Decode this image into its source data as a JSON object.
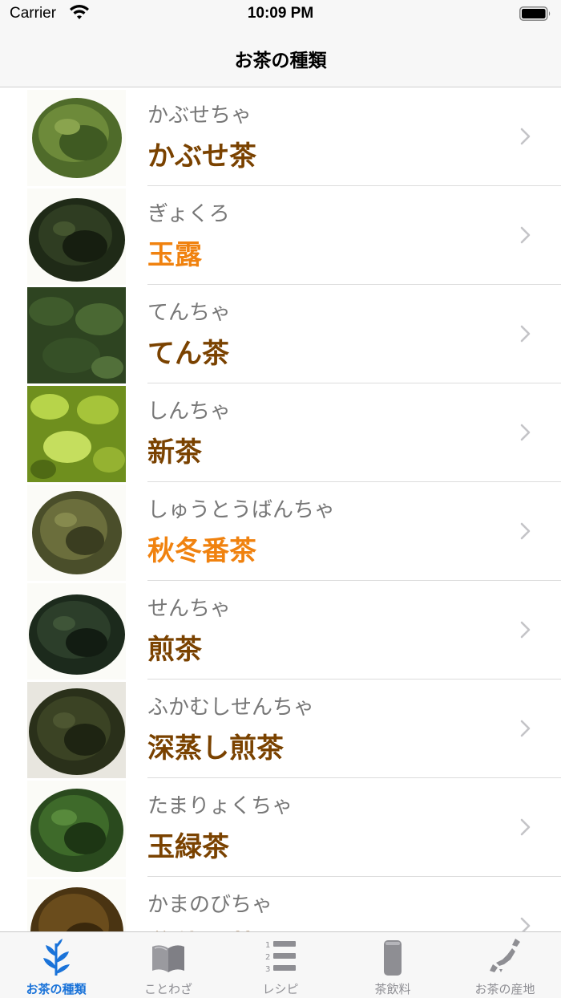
{
  "status_bar": {
    "carrier": "Carrier",
    "time": "10:09 PM"
  },
  "nav": {
    "title": "お茶の種類"
  },
  "colors": {
    "brown": "#7a4200",
    "orange": "#f0820f",
    "reading": "#777777",
    "tab_active": "#1a73d9",
    "tab_inactive": "#8e8e93"
  },
  "teas": [
    {
      "reading": "かぶせちゃ",
      "name": "かぶせ茶",
      "name_color": "#7a4200",
      "thumb": "loose-leaf"
    },
    {
      "reading": "ぎょくろ",
      "name": "玉露",
      "name_color": "#f0820f",
      "thumb": "dark-needle"
    },
    {
      "reading": "てんちゃ",
      "name": "てん茶",
      "name_color": "#7a4200",
      "thumb": "flakes"
    },
    {
      "reading": "しんちゃ",
      "name": "新茶",
      "name_color": "#7a4200",
      "thumb": "fresh-leaves"
    },
    {
      "reading": "しゅうとうばんちゃ",
      "name": "秋冬番茶",
      "name_color": "#f0820f",
      "thumb": "loose-leaf"
    },
    {
      "reading": "せんちゃ",
      "name": "煎茶",
      "name_color": "#7a4200",
      "thumb": "dark-needle"
    },
    {
      "reading": "ふかむしせんちゃ",
      "name": "深蒸し煎茶",
      "name_color": "#7a4200",
      "thumb": "dark-fine"
    },
    {
      "reading": "たまりょくちゃ",
      "name": "玉緑茶",
      "name_color": "#7a4200",
      "thumb": "curled"
    },
    {
      "reading": "かまのびちゃ",
      "name": "釜伸び茶",
      "name_color": "#7a4200",
      "thumb": "brown"
    }
  ],
  "tabs": [
    {
      "label": "お茶の種類",
      "icon": "tea-plant-icon",
      "active": true
    },
    {
      "label": "ことわざ",
      "icon": "book-icon",
      "active": false
    },
    {
      "label": "レシピ",
      "icon": "numbered-list-icon",
      "active": false
    },
    {
      "label": "茶飲料",
      "icon": "can-icon",
      "active": false
    },
    {
      "label": "お茶の産地",
      "icon": "japan-map-icon",
      "active": false
    }
  ]
}
